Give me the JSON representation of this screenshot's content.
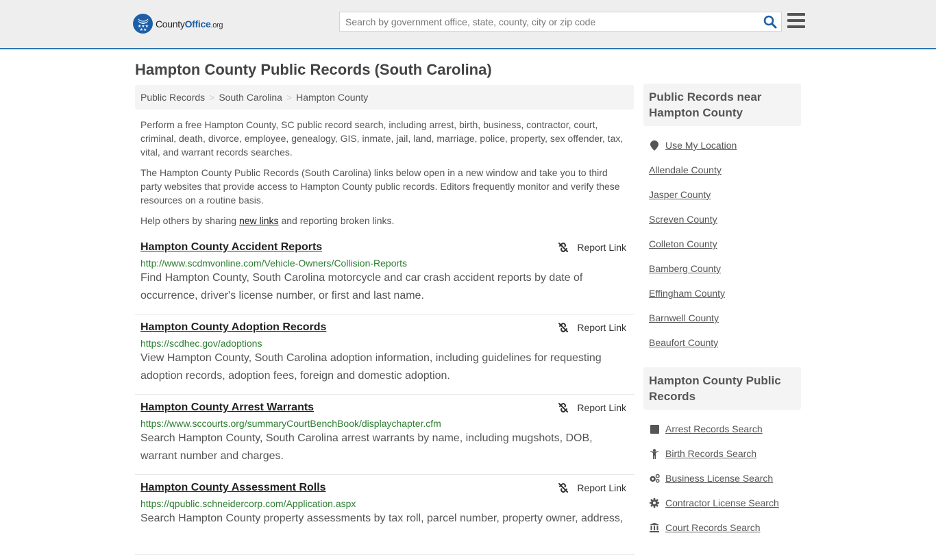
{
  "header": {
    "logo": {
      "brand_prefix": "County",
      "brand_main": "Office",
      "brand_suffix": ".org"
    },
    "search": {
      "placeholder": "Search by government office, state, county, city or zip code",
      "value": ""
    },
    "colors": {
      "accent": "#2d77b4",
      "logo_blue": "#1e5ea6",
      "url_green": "#2e7d32"
    }
  },
  "page": {
    "title": "Hampton County Public Records (South Carolina)",
    "breadcrumb": [
      "Public Records",
      "South Carolina",
      "Hampton County"
    ],
    "intro": {
      "p1": "Perform a free Hampton County, SC public record search, including arrest, birth, business, contractor, court, criminal, death, divorce, employee, genealogy, GIS, inmate, jail, land, marriage, police, property, sex offender, tax, vital, and warrant records searches.",
      "p2": "The Hampton County Public Records (South Carolina) links below open in a new window and take you to third party websites that provide access to Hampton County public records. Editors frequently monitor and verify these resources on a routine basis.",
      "p3_before": "Help others by sharing ",
      "p3_link": "new links",
      "p3_after": " and reporting broken links."
    },
    "report_label": "Report Link",
    "records": [
      {
        "title": "Hampton County Accident Reports",
        "url": "http://www.scdmvonline.com/Vehicle-Owners/Collision-Reports",
        "desc": "Find Hampton County, South Carolina motorcycle and car crash accident reports by date of occurrence, driver's license number, or first and last name."
      },
      {
        "title": "Hampton County Adoption Records",
        "url": "https://scdhec.gov/adoptions",
        "desc": "View Hampton County, South Carolina adoption information, including guidelines for requesting adoption records, adoption fees, foreign and domestic adoption."
      },
      {
        "title": "Hampton County Arrest Warrants",
        "url": "https://www.sccourts.org/summaryCourtBenchBook/displaychapter.cfm",
        "desc": "Search Hampton County, South Carolina arrest warrants by name, including mugshots, DOB, warrant number and charges."
      },
      {
        "title": "Hampton County Assessment Rolls",
        "url": "https://qpublic.schneidercorp.com/Application.aspx",
        "desc": "Search Hampton County property assessments by tax roll, parcel number, property owner, address,"
      }
    ]
  },
  "sidebar": {
    "nearby": {
      "heading": "Public Records near Hampton County",
      "use_location": "Use My Location",
      "items": [
        "Allendale County",
        "Jasper County",
        "Screven County",
        "Colleton County",
        "Bamberg County",
        "Effingham County",
        "Barnwell County",
        "Beaufort County"
      ]
    },
    "county_records": {
      "heading": "Hampton County Public Records",
      "items": [
        {
          "label": "Arrest Records Search",
          "icon": "square-icon"
        },
        {
          "label": "Birth Records Search",
          "icon": "child-icon"
        },
        {
          "label": "Business License Search",
          "icon": "cogs-icon"
        },
        {
          "label": "Contractor License Search",
          "icon": "gear-icon"
        },
        {
          "label": "Court Records Search",
          "icon": "courthouse-icon"
        }
      ]
    }
  }
}
